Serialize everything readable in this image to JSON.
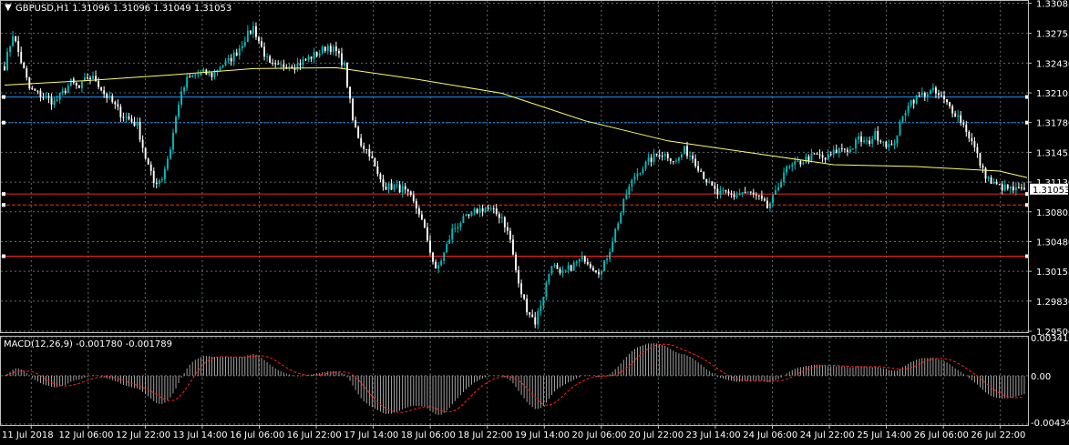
{
  "header": {
    "main_info": "GBPUSD,H1  1.31096 1.31096 1.31049 1.31053",
    "macd_info": "MACD(12,26,9) -0.001780 -0.001789"
  },
  "colors": {
    "background": "#000000",
    "grid": "#5f6b6b",
    "frame": "#c0c0c0",
    "bull_candle": "#00bfbf",
    "bear_candle": "#ffffff",
    "moving_average": "#ffff66",
    "blue_level": "#1e90ff",
    "red_level": "#ff2020",
    "macd_histogram": "#c8c8c8",
    "macd_signal": "#ff2020",
    "current_price_tag": "#ffffff"
  },
  "chart_data": [
    {
      "type": "candlestick",
      "title": "GBPUSD,H1",
      "symbol": "GBPUSD",
      "timeframe": "H1",
      "last_bar": {
        "open": 1.31096,
        "high": 1.31096,
        "low": 1.31049,
        "close": 1.31053
      },
      "current_price_label": "1.31053",
      "price_ticks": [
        "1.33085",
        "1.32755",
        "1.32430",
        "1.32105",
        "1.31780",
        "1.31455",
        "1.31130",
        "1.30805",
        "1.30480",
        "1.30155",
        "1.29830",
        "1.29500"
      ],
      "ylim": [
        1.295,
        1.3308
      ],
      "time_ticks": [
        "11 Jul 2018",
        "12 Jul 06:00",
        "12 Jul 22:00",
        "13 Jul 14:00",
        "16 Jul 06:00",
        "16 Jul 22:00",
        "17 Jul 14:00",
        "18 Jul 06:00",
        "18 Jul 22:00",
        "19 Jul 14:00",
        "20 Jul 06:00",
        "20 Jul 22:00",
        "23 Jul 14:00",
        "24 Jul 06:00",
        "24 Jul 22:00",
        "25 Jul 14:00",
        "26 Jul 06:00",
        "26 Jul 22:00"
      ],
      "grid": true,
      "close_path": [
        [
          0,
          1.324
        ],
        [
          3,
          1.3275
        ],
        [
          6,
          1.3245
        ],
        [
          9,
          1.3215
        ],
        [
          12,
          1.321
        ],
        [
          15,
          1.3205
        ],
        [
          18,
          1.32
        ],
        [
          21,
          1.321
        ],
        [
          24,
          1.3222
        ],
        [
          27,
          1.3215
        ],
        [
          30,
          1.3228
        ],
        [
          33,
          1.3225
        ],
        [
          36,
          1.321
        ],
        [
          39,
          1.32
        ],
        [
          42,
          1.3188
        ],
        [
          45,
          1.3182
        ],
        [
          48,
          1.3175
        ],
        [
          51,
          1.314
        ],
        [
          54,
          1.3112
        ],
        [
          57,
          1.3118
        ],
        [
          60,
          1.315
        ],
        [
          63,
          1.32
        ],
        [
          66,
          1.3225
        ],
        [
          69,
          1.323
        ],
        [
          72,
          1.3232
        ],
        [
          75,
          1.323
        ],
        [
          78,
          1.324
        ],
        [
          81,
          1.3245
        ],
        [
          84,
          1.3255
        ],
        [
          87,
          1.327
        ],
        [
          90,
          1.3282
        ],
        [
          93,
          1.326
        ],
        [
          96,
          1.324
        ],
        [
          99,
          1.3238
        ],
        [
          102,
          1.3242
        ],
        [
          105,
          1.324
        ],
        [
          108,
          1.3245
        ],
        [
          111,
          1.325
        ],
        [
          114,
          1.3255
        ],
        [
          117,
          1.3262
        ],
        [
          120,
          1.3255
        ],
        [
          123,
          1.324
        ],
        [
          126,
          1.318
        ],
        [
          129,
          1.3155
        ],
        [
          132,
          1.3145
        ],
        [
          135,
          1.312
        ],
        [
          138,
          1.3108
        ],
        [
          141,
          1.3108
        ],
        [
          144,
          1.3105
        ],
        [
          147,
          1.3095
        ],
        [
          150,
          1.308
        ],
        [
          153,
          1.305
        ],
        [
          156,
          1.3015
        ],
        [
          159,
          1.3035
        ],
        [
          162,
          1.306
        ],
        [
          165,
          1.307
        ],
        [
          168,
          1.3075
        ],
        [
          171,
          1.3082
        ],
        [
          174,
          1.3085
        ],
        [
          177,
          1.308
        ],
        [
          180,
          1.3075
        ],
        [
          183,
          1.305
        ],
        [
          186,
          1.3
        ],
        [
          189,
          1.2975
        ],
        [
          192,
          1.296
        ],
        [
          195,
          1.299
        ],
        [
          198,
          1.3025
        ],
        [
          201,
          1.301
        ],
        [
          204,
          1.3018
        ],
        [
          207,
          1.3025
        ],
        [
          210,
          1.303
        ],
        [
          213,
          1.302
        ],
        [
          216,
          1.3015
        ],
        [
          219,
          1.304
        ],
        [
          222,
          1.307
        ],
        [
          225,
          1.31
        ],
        [
          228,
          1.312
        ],
        [
          231,
          1.313
        ],
        [
          234,
          1.3138
        ],
        [
          237,
          1.3145
        ],
        [
          240,
          1.3142
        ],
        [
          243,
          1.3135
        ],
        [
          246,
          1.3148
        ],
        [
          249,
          1.314
        ],
        [
          252,
          1.3125
        ],
        [
          255,
          1.311
        ],
        [
          258,
          1.31
        ],
        [
          261,
          1.31
        ],
        [
          264,
          1.3098
        ],
        [
          267,
          1.3102
        ],
        [
          270,
          1.31
        ],
        [
          273,
          1.3095
        ],
        [
          276,
          1.3085
        ],
        [
          279,
          1.31
        ],
        [
          282,
          1.3125
        ],
        [
          285,
          1.313
        ],
        [
          288,
          1.3135
        ],
        [
          291,
          1.314
        ],
        [
          294,
          1.3142
        ],
        [
          297,
          1.3138
        ],
        [
          300,
          1.3145
        ],
        [
          303,
          1.315
        ],
        [
          306,
          1.3148
        ],
        [
          309,
          1.316
        ],
        [
          312,
          1.3155
        ],
        [
          315,
          1.3165
        ],
        [
          318,
          1.3158
        ],
        [
          321,
          1.315
        ],
        [
          324,
          1.3175
        ],
        [
          327,
          1.32
        ],
        [
          330,
          1.3205
        ],
        [
          333,
          1.321
        ],
        [
          336,
          1.3212
        ],
        [
          339,
          1.3205
        ],
        [
          342,
          1.3195
        ],
        [
          345,
          1.3185
        ],
        [
          348,
          1.317
        ],
        [
          351,
          1.315
        ],
        [
          354,
          1.3125
        ],
        [
          357,
          1.3112
        ],
        [
          360,
          1.3108
        ],
        [
          363,
          1.3106
        ],
        [
          366,
          1.3104
        ],
        [
          369,
          1.3105
        ]
      ],
      "moving_average": [
        [
          0,
          1.3219
        ],
        [
          30,
          1.3224
        ],
        [
          60,
          1.323
        ],
        [
          90,
          1.3237
        ],
        [
          120,
          1.3238
        ],
        [
          150,
          1.3225
        ],
        [
          180,
          1.321
        ],
        [
          210,
          1.318
        ],
        [
          240,
          1.3158
        ],
        [
          270,
          1.3145
        ],
        [
          300,
          1.3132
        ],
        [
          330,
          1.313
        ],
        [
          360,
          1.3125
        ],
        [
          370,
          1.3118
        ]
      ],
      "horizontal_levels": [
        {
          "price": 1.3206,
          "color": "#1e90ff",
          "style": "solid"
        },
        {
          "price": 1.3178,
          "color": "#1e90ff",
          "style": "dotted"
        },
        {
          "price": 1.31,
          "color": "#ff2020",
          "style": "solid"
        },
        {
          "price": 1.3088,
          "color": "#ff2020",
          "style": "dashed"
        },
        {
          "price": 1.3032,
          "color": "#ff2020",
          "style": "solid"
        }
      ]
    },
    {
      "type": "macd",
      "title": "MACD(12,26,9)",
      "values": {
        "macd": -0.00178,
        "signal": -0.001789
      },
      "ticks": [
        "0.003416",
        "0.00",
        "-0.004345"
      ],
      "ylim": [
        -0.004345,
        0.003416
      ],
      "grid": true
    }
  ]
}
